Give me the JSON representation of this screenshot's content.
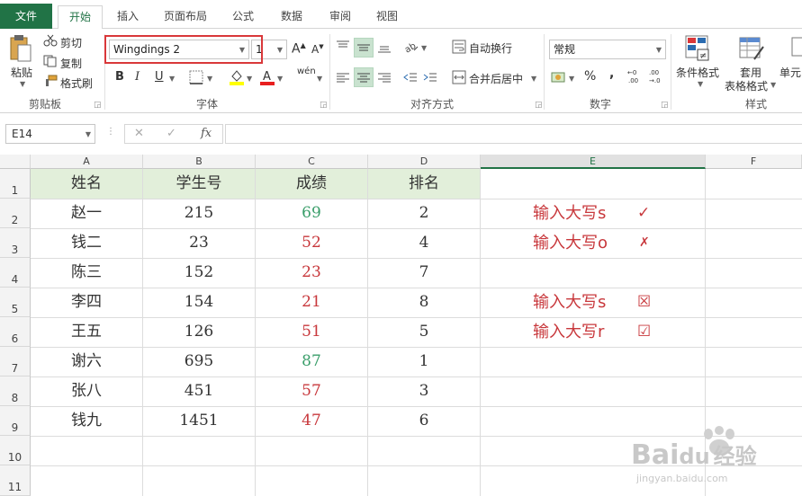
{
  "tabs": [
    "文件",
    "开始",
    "插入",
    "页面布局",
    "公式",
    "数据",
    "审阅",
    "视图"
  ],
  "clipboard": {
    "paste_label": "粘贴",
    "cut_label": "剪切",
    "copy_label": "复制",
    "format_painter_label": "格式刷",
    "group_label": "剪贴板"
  },
  "font": {
    "font_name": "Wingdings 2",
    "font_size": "1",
    "grow_label": "A",
    "shrink_label": "A",
    "bold_label": "B",
    "italic_label": "I",
    "underline_label": "U",
    "font_color_label": "A",
    "phonetic_label": "wén",
    "group_label": "字体"
  },
  "alignment": {
    "wrap_label": "自动换行",
    "merge_label": "合并后居中",
    "group_label": "对齐方式"
  },
  "number": {
    "format_value": "常规",
    "percent_label": "%",
    "comma_label": ",",
    "group_label": "数字"
  },
  "styles": {
    "conditional_label": "条件格式",
    "table_label_1": "套用",
    "table_label_2": "表格格式",
    "cell_label": "单元",
    "group_label": "样式"
  },
  "formula_bar": {
    "name_box": "E14",
    "cancel_label": "✕",
    "confirm_label": "✓",
    "fx_label": "fx"
  },
  "columns": [
    "A",
    "B",
    "C",
    "D",
    "E",
    "F"
  ],
  "rows": [
    "1",
    "2",
    "3",
    "4",
    "5",
    "6",
    "7",
    "8",
    "9",
    "10",
    "11"
  ],
  "table": {
    "headers": [
      "姓名",
      "学生号",
      "成绩",
      "排名"
    ],
    "data": [
      [
        "赵一",
        "215",
        "69",
        "2"
      ],
      [
        "钱二",
        "23",
        "52",
        "4"
      ],
      [
        "陈三",
        "152",
        "23",
        "7"
      ],
      [
        "李四",
        "154",
        "21",
        "8"
      ],
      [
        "王五",
        "126",
        "51",
        "5"
      ],
      [
        "谢六",
        "695",
        "87",
        "1"
      ],
      [
        "张八",
        "451",
        "57",
        "3"
      ],
      [
        "钱九",
        "1451",
        "47",
        "6"
      ]
    ]
  },
  "notes": [
    {
      "text": "输入大写s",
      "symbol": "✓"
    },
    {
      "text": "输入大写o",
      "symbol": "✗"
    },
    {
      "text": "输入大写s",
      "symbol": "☒"
    },
    {
      "text": "输入大写r",
      "symbol": "☑"
    }
  ],
  "colors": {
    "accent": "#217346",
    "header_fill": "#e2efda",
    "score_pass": "#3a9e6a",
    "score_fail": "#c8383c"
  },
  "watermark": {
    "brand": "Bai",
    "brand2": "du",
    "cn": "经验",
    "url": "jingyan.baidu.com"
  }
}
